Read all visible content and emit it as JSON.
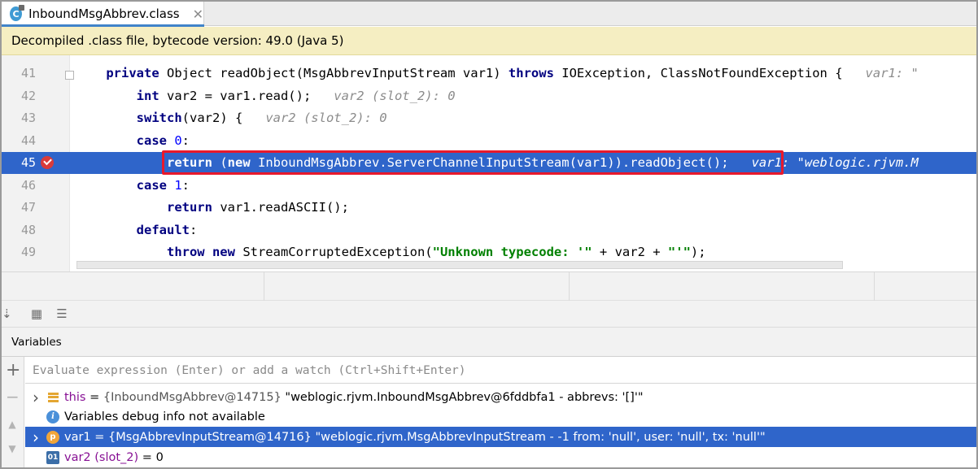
{
  "tab": {
    "label": "InboundMsgAbbrev.class",
    "icon": "class-icon",
    "close": "✕"
  },
  "notice": {
    "text": "Decompiled .class file, bytecode version: 49.0 (Java 5)"
  },
  "editor": {
    "lines": [
      {
        "num": "41",
        "tokens": [
          {
            "t": "    ",
            "c": ""
          },
          {
            "t": "private ",
            "c": "kw"
          },
          {
            "t": "Object readObject(MsgAbbrevInputStream var1) ",
            "c": ""
          },
          {
            "t": "throws ",
            "c": "kw"
          },
          {
            "t": "IOException, ClassNotFoundException {   ",
            "c": ""
          },
          {
            "t": "var1: \"",
            "c": "hint"
          }
        ]
      },
      {
        "num": "42",
        "tokens": [
          {
            "t": "        ",
            "c": ""
          },
          {
            "t": "int ",
            "c": "kw"
          },
          {
            "t": "var2 = var1.read();   ",
            "c": ""
          },
          {
            "t": "var2 (slot_2): 0",
            "c": "hint"
          }
        ]
      },
      {
        "num": "43",
        "tokens": [
          {
            "t": "        ",
            "c": ""
          },
          {
            "t": "switch",
            "c": "kw"
          },
          {
            "t": "(var2) {   ",
            "c": ""
          },
          {
            "t": "var2 (slot_2): 0",
            "c": "hint"
          }
        ]
      },
      {
        "num": "44",
        "tokens": [
          {
            "t": "        ",
            "c": ""
          },
          {
            "t": "case ",
            "c": "kw"
          },
          {
            "t": "0",
            "c": "num"
          },
          {
            "t": ":",
            "c": ""
          }
        ]
      },
      {
        "num": "45",
        "highlight": true,
        "tokens": [
          {
            "t": "            ",
            "c": ""
          },
          {
            "t": "return ",
            "c": "kw"
          },
          {
            "t": "(",
            "c": ""
          },
          {
            "t": "new ",
            "c": "kw"
          },
          {
            "t": "InboundMsgAbbrev.ServerChannelInputStream(var1)).readObject();   ",
            "c": ""
          },
          {
            "t": "var1: \"weblogic.rjvm.M",
            "c": "hint"
          }
        ]
      },
      {
        "num": "46",
        "tokens": [
          {
            "t": "        ",
            "c": ""
          },
          {
            "t": "case ",
            "c": "kw"
          },
          {
            "t": "1",
            "c": "num"
          },
          {
            "t": ":",
            "c": ""
          }
        ]
      },
      {
        "num": "47",
        "tokens": [
          {
            "t": "            ",
            "c": ""
          },
          {
            "t": "return ",
            "c": "kw"
          },
          {
            "t": "var1.readASCII();",
            "c": ""
          }
        ]
      },
      {
        "num": "48",
        "tokens": [
          {
            "t": "        ",
            "c": ""
          },
          {
            "t": "default",
            "c": "kw"
          },
          {
            "t": ":",
            "c": ""
          }
        ]
      },
      {
        "num": "49",
        "tokens": [
          {
            "t": "            ",
            "c": ""
          },
          {
            "t": "throw new ",
            "c": "kw"
          },
          {
            "t": "StreamCorruptedException(",
            "c": ""
          },
          {
            "t": "\"Unknown typecode: '\"",
            "c": "str"
          },
          {
            "t": " + var2 + ",
            "c": ""
          },
          {
            "t": "\"'\"",
            "c": "str"
          },
          {
            "t": ");",
            "c": ""
          }
        ]
      }
    ]
  },
  "debugger": {
    "panel_title": "Variables",
    "watch_placeholder": "Evaluate expression (Enter) or add a watch (Ctrl+Shift+Enter)",
    "side_icons": [
      "add-icon",
      "remove-icon",
      "move-up-icon",
      "move-down-icon"
    ],
    "variables": [
      {
        "kind": "field",
        "expandable": true,
        "selected": false,
        "name": "this",
        "eq": " = ",
        "type": "{InboundMsgAbbrev@14715} ",
        "value": "\"weblogic.rjvm.InboundMsgAbbrev@6fddbfa1 - abbrevs: '[]'\""
      },
      {
        "kind": "info",
        "expandable": false,
        "selected": false,
        "text": "Variables debug info not available"
      },
      {
        "kind": "param",
        "expandable": true,
        "selected": true,
        "name": "var1",
        "eq": " = ",
        "type": "{MsgAbbrevInputStream@14716} ",
        "value": "\"weblogic.rjvm.MsgAbbrevInputStream - -1 from: 'null', user: 'null', tx: 'null'\""
      },
      {
        "kind": "prim",
        "expandable": false,
        "selected": false,
        "name": "var2 (slot_2)",
        "eq": " = ",
        "type": "",
        "value": "0"
      }
    ]
  },
  "colors": {
    "selection": "#2f65ca",
    "notice_bg": "#f5eec2",
    "breakpoint": "#d93b3b",
    "highlight_box": "#e8192c"
  }
}
